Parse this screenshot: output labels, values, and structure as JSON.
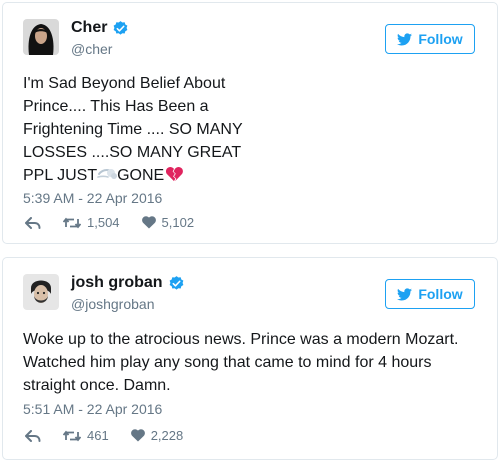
{
  "tweets": [
    {
      "name": "Cher",
      "handle": "@cher",
      "follow_label": "Follow",
      "text_lines": [
        "I'm Sad Beyond Belief About",
        "Prince.... This Has Been a",
        "Frightening Time .... SO MANY",
        "LOSSES ....SO MANY GREAT"
      ],
      "text_last_a": "PPL JUST",
      "text_last_b": "GONE",
      "timestamp": "5:39 AM - 22 Apr 2016",
      "retweets": "1,504",
      "likes": "5,102",
      "emojis": [
        "dash-emoji",
        "broken-heart-emoji"
      ]
    },
    {
      "name": "josh groban",
      "handle": "@joshgroban",
      "follow_label": "Follow",
      "text": "Woke up to the atrocious news. Prince was a modern Mozart.\nWatched him play any song that came to mind for 4 hours\nstraight once. Damn.",
      "timestamp": "5:51 AM - 22 Apr 2016",
      "retweets": "461",
      "likes": "2,228"
    }
  ],
  "colors": {
    "accent": "#1da1f2",
    "muted": "#657786",
    "border": "#e1e8ed",
    "broken_heart": "#e0245e"
  },
  "icons": [
    "verified-badge-icon",
    "twitter-bird-icon",
    "reply-icon",
    "retweet-icon",
    "heart-icon"
  ]
}
